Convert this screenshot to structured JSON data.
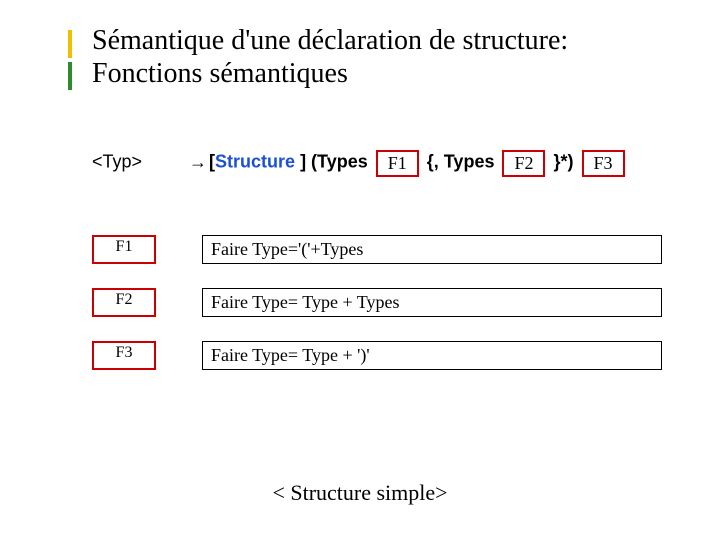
{
  "title": "Sémantique d'une déclaration de structure:\nFonctions sémantiques",
  "rule": {
    "lhs": "<Typ>",
    "arrow": "→",
    "open_br": "[",
    "kw": "Structure",
    "seg1": " ]  (Types ",
    "f1": "F1",
    "seg2": " {, Types ",
    "f2": "F2",
    "seg3": " }*) ",
    "f3": "F3"
  },
  "defs": [
    {
      "label": "F1",
      "body": "Faire Type='('+Types"
    },
    {
      "label": "F2",
      "body": "Faire Type= Type + Types"
    },
    {
      "label": "F3",
      "body": "Faire Type= Type + ')'"
    }
  ],
  "footer": "< Structure simple>"
}
